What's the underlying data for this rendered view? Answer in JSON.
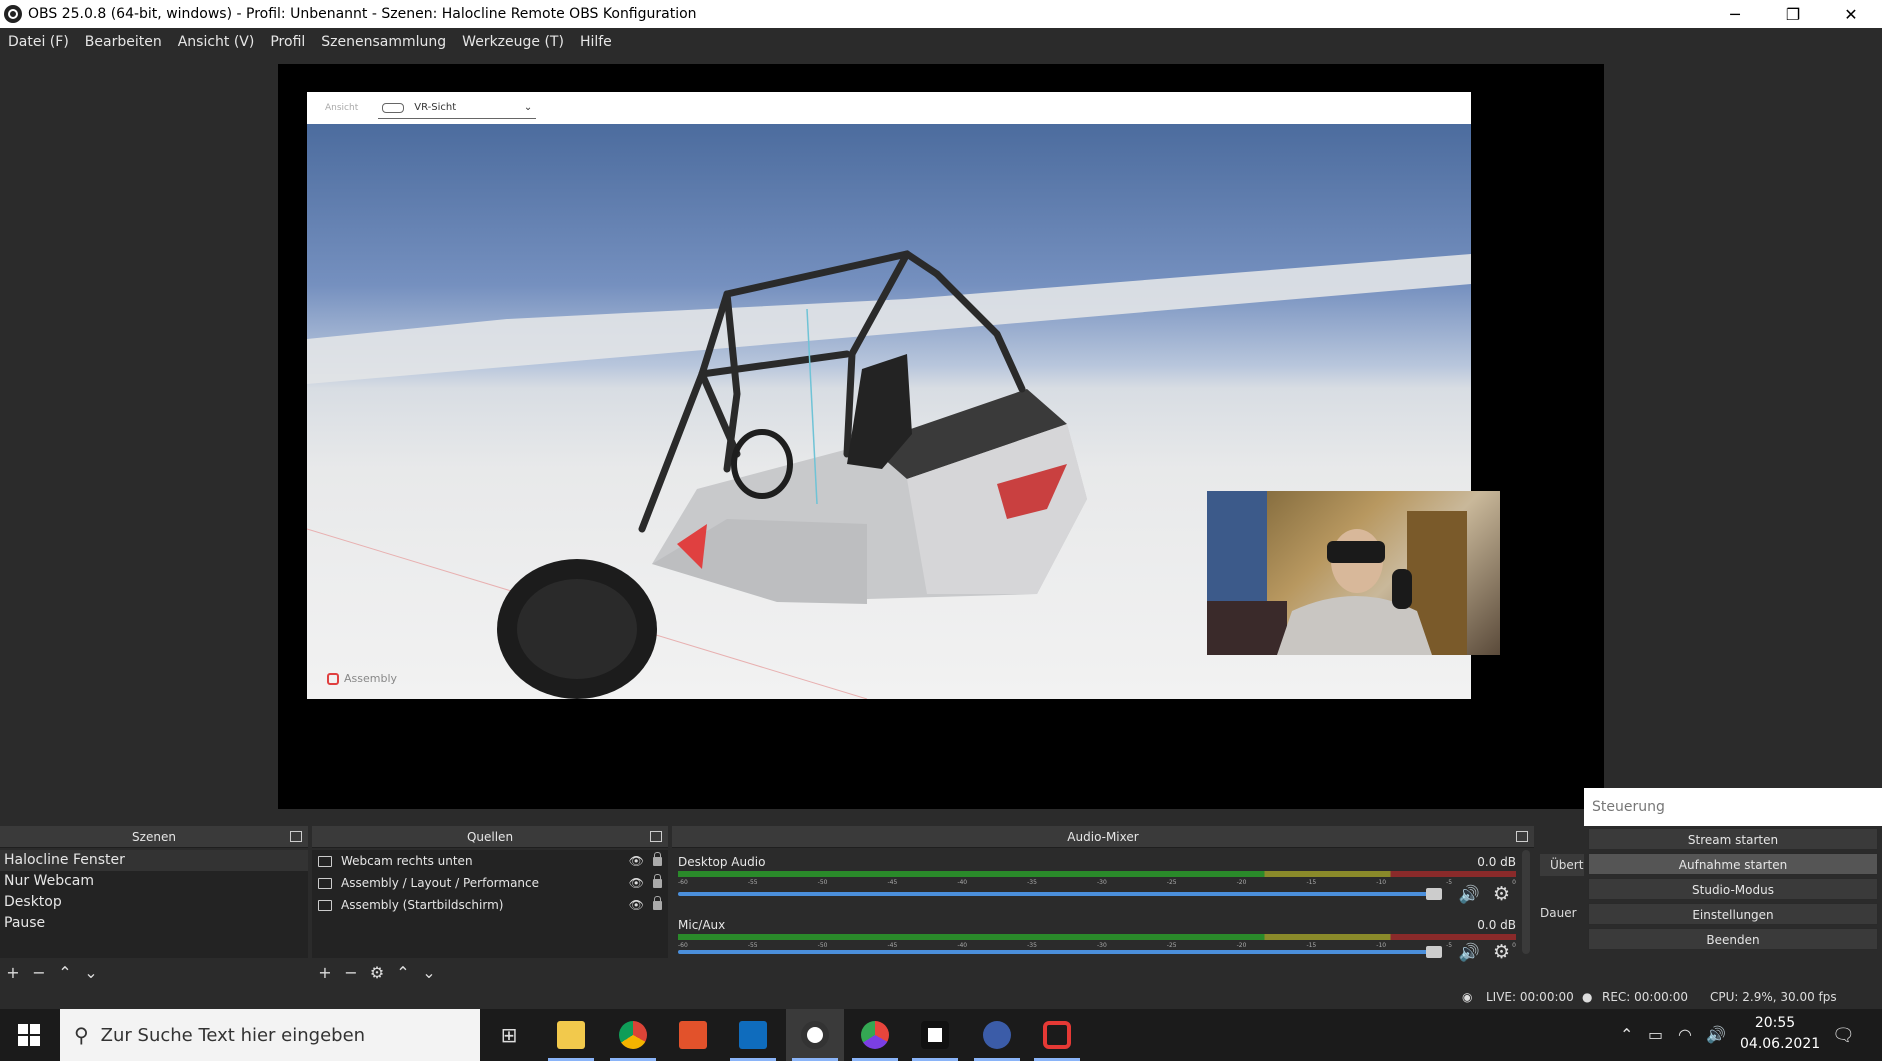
{
  "window": {
    "title": "OBS 25.0.8 (64-bit, windows) - Profil: Unbenannt - Szenen: Halocline Remote OBS Konfiguration",
    "minimize": "─",
    "restore": "❐",
    "close": "✕"
  },
  "menu": [
    "Datei (F)",
    "Bearbeiten",
    "Ansicht (V)",
    "Profil",
    "Szenensammlung",
    "Werkzeuge (T)",
    "Hilfe"
  ],
  "preview": {
    "vr_toolbar": {
      "ansicht_label": "Ansicht",
      "view_select": "VR-Sicht"
    },
    "logo_text": "Assembly"
  },
  "scenes": {
    "title": "Szenen",
    "items": [
      "Halocline Fenster",
      "Nur Webcam",
      "Desktop",
      "Pause"
    ]
  },
  "sources": {
    "title": "Quellen",
    "items": [
      "Webcam rechts unten",
      "Assembly / Layout / Performance",
      "Assembly (Startbildschirm)"
    ]
  },
  "mixer": {
    "title": "Audio-Mixer",
    "tracks": [
      {
        "name": "Desktop Audio",
        "db": "0.0 dB"
      },
      {
        "name": "Mic/Aux",
        "db": "0.0 dB"
      }
    ],
    "ticks": [
      "-60",
      "-55",
      "-50",
      "-45",
      "-40",
      "-35",
      "-30",
      "-25",
      "-20",
      "-15",
      "-10",
      "-5",
      "0"
    ]
  },
  "transitions": {
    "label_top": "Übert",
    "label_duration": "Dauer"
  },
  "controls": {
    "title": "Steuerung",
    "buttons": [
      "Stream starten",
      "Aufnahme starten",
      "Studio-Modus",
      "Einstellungen",
      "Beenden"
    ]
  },
  "status": {
    "live": "LIVE: 00:00:00",
    "rec": "REC: 00:00:00",
    "cpu": "CPU: 2.9%, 30.00 fps"
  },
  "taskbar": {
    "search_placeholder": "Zur Suche Text hier eingeben",
    "time": "20:55",
    "date": "04.06.2021"
  },
  "colors": {
    "obs_bg": "#2b2b2b",
    "meter_green": "#2a8a2a",
    "fader_blue": "#4b8fdb",
    "accent_red": "#e04040"
  }
}
